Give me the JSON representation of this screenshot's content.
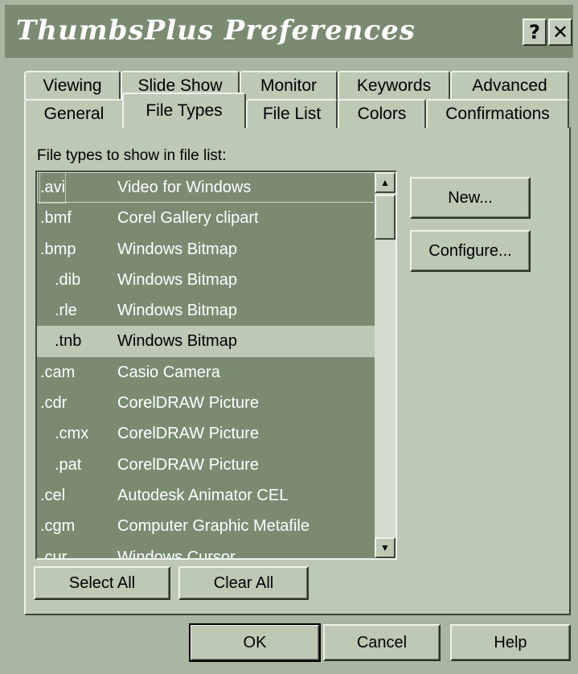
{
  "window": {
    "title": "ThumbsPlus Preferences",
    "help_label": "?",
    "close_label": "✕"
  },
  "tabs": {
    "row1": [
      "Viewing",
      "Slide Show",
      "Monitor",
      "Keywords",
      "Advanced"
    ],
    "row2": [
      "General",
      "File Types",
      "File List",
      "Colors",
      "Confirmations"
    ],
    "active": "File Types"
  },
  "panel": {
    "list_label": "File types to show in file list:",
    "rows": [
      {
        "ext": ".avi",
        "desc": "Video for Windows",
        "sub": false
      },
      {
        "ext": ".bmf",
        "desc": "Corel Gallery clipart",
        "sub": false
      },
      {
        "ext": ".bmp",
        "desc": "Windows Bitmap",
        "sub": false
      },
      {
        "ext": ".dib",
        "desc": "Windows Bitmap",
        "sub": true
      },
      {
        "ext": ".rle",
        "desc": "Windows Bitmap",
        "sub": true
      },
      {
        "ext": ".tnb",
        "desc": "Windows Bitmap",
        "sub": true
      },
      {
        "ext": ".cam",
        "desc": "Casio Camera",
        "sub": false
      },
      {
        "ext": ".cdr",
        "desc": "CorelDRAW Picture",
        "sub": false
      },
      {
        "ext": ".cmx",
        "desc": "CorelDRAW Picture",
        "sub": true
      },
      {
        "ext": ".pat",
        "desc": "CorelDRAW Picture",
        "sub": true
      },
      {
        "ext": ".cel",
        "desc": "Autodesk Animator CEL",
        "sub": false
      },
      {
        "ext": ".cgm",
        "desc": "Computer Graphic Metafile",
        "sub": false
      },
      {
        "ext": ".cur",
        "desc": "Windows Cursor",
        "sub": false
      }
    ],
    "new_button": "New...",
    "configure_button": "Configure...",
    "select_all_button": "Select All",
    "clear_all_button": "Clear All"
  },
  "footer": {
    "ok": "OK",
    "cancel": "Cancel",
    "help": "Help"
  }
}
